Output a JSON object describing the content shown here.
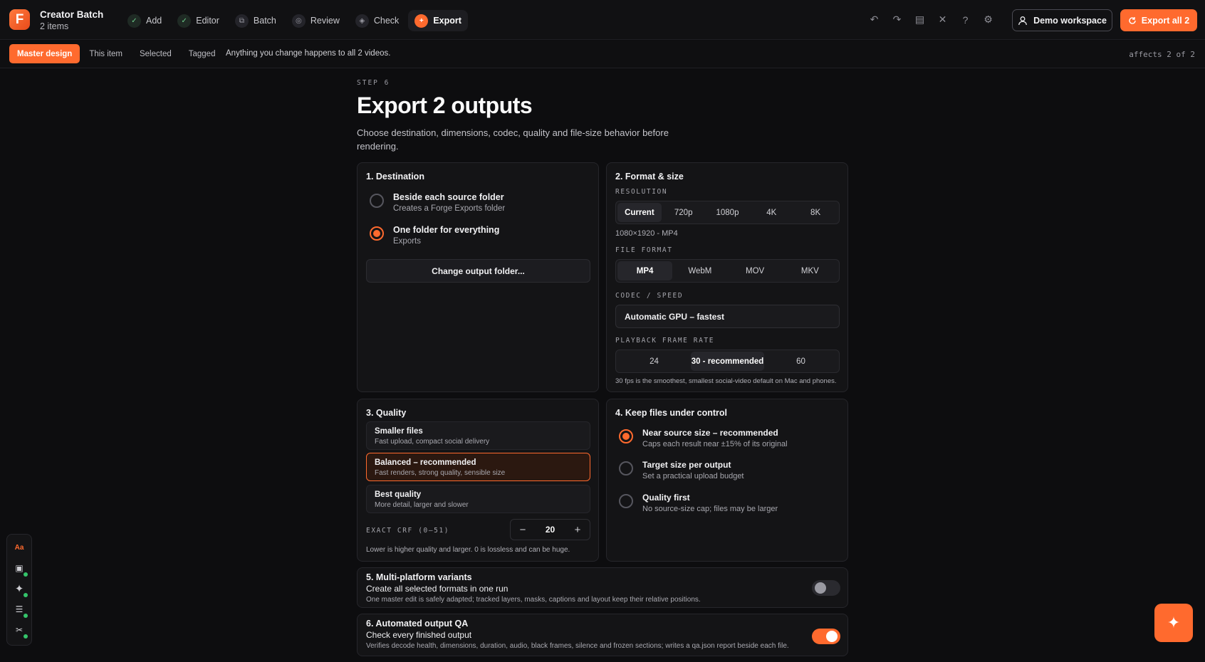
{
  "app": {
    "logo_letter": "F",
    "title": "Creator Batch",
    "subtitle": "2 items"
  },
  "steps": [
    {
      "label": "Add",
      "state": "done"
    },
    {
      "label": "Editor",
      "state": "done"
    },
    {
      "label": "Batch",
      "state": "pending"
    },
    {
      "label": "Review",
      "state": "pending"
    },
    {
      "label": "Check",
      "state": "pending"
    },
    {
      "label": "Export",
      "state": "active"
    }
  ],
  "toolbar": {
    "workspace_label": "Demo workspace",
    "export_label": "Export all 2",
    "icons": [
      "undo-icon",
      "redo-icon",
      "list-icon",
      "close-icon",
      "help-icon",
      "gear-icon"
    ]
  },
  "scope": {
    "tabs": [
      {
        "label": "Master design",
        "active": true
      },
      {
        "label": "This item",
        "active": false
      },
      {
        "label": "Selected",
        "active": false
      },
      {
        "label": "Tagged",
        "active": false
      }
    ],
    "message": "Anything you change happens to all 2 videos.",
    "affects": "affects 2 of 2"
  },
  "page": {
    "step_label": "STEP 6",
    "title": "Export 2 outputs",
    "description": "Choose destination, dimensions, codec, quality and file-size behavior before rendering."
  },
  "destination": {
    "title": "1. Destination",
    "options": [
      {
        "label": "Beside each source folder",
        "sub": "Creates a Forge Exports folder",
        "selected": false
      },
      {
        "label": "One folder for everything",
        "sub": "Exports",
        "selected": true
      }
    ],
    "change_button": "Change output folder..."
  },
  "format": {
    "title": "2. Format & size",
    "resolution_label": "RESOLUTION",
    "resolutions": [
      "Current",
      "720p",
      "1080p",
      "4K",
      "8K"
    ],
    "resolution_selected": "Current",
    "resolution_note": "1080×1920 - MP4",
    "file_format_label": "FILE FORMAT",
    "file_formats": [
      "MP4",
      "WebM",
      "MOV",
      "MKV"
    ],
    "file_format_selected": "MP4",
    "codec_label": "CODEC / SPEED",
    "codec_value": "Automatic GPU – fastest",
    "framerate_label": "PLAYBACK FRAME RATE",
    "framerates": [
      "24",
      "30 - recommended",
      "60"
    ],
    "framerate_selected": "30 - recommended",
    "framerate_note": "30 fps is the smoothest, smallest social-video default on Mac and phones."
  },
  "quality": {
    "title": "3. Quality",
    "options": [
      {
        "label": "Smaller files",
        "sub": "Fast upload, compact social delivery",
        "selected": false
      },
      {
        "label": "Balanced – recommended",
        "sub": "Fast renders, strong quality, sensible size",
        "selected": true
      },
      {
        "label": "Best quality",
        "sub": "More detail, larger and slower",
        "selected": false
      }
    ],
    "crf_label": "EXACT CRF (0–51)",
    "crf_value": "20",
    "crf_note": "Lower is higher quality and larger. 0 is lossless and can be huge."
  },
  "filesize": {
    "title": "4. Keep files under control",
    "options": [
      {
        "label": "Near source size – recommended",
        "sub": "Caps each result near ±15% of its original",
        "selected": true
      },
      {
        "label": "Target size per output",
        "sub": "Set a practical upload budget",
        "selected": false
      },
      {
        "label": "Quality first",
        "sub": "No source-size cap; files may be larger",
        "selected": false
      }
    ]
  },
  "variants": {
    "title": "5. Multi-platform variants",
    "heading": "Create all selected formats in one run",
    "description": "One master edit is safely adapted; tracked layers, masks, captions and layout keep their relative positions.",
    "enabled": false
  },
  "qa": {
    "title": "6. Automated output QA",
    "heading": "Check every finished output",
    "description": "Verifies decode health, dimensions, duration, audio, black frames, silence and frozen sections; writes a qa.json report beside each file.",
    "enabled": true
  },
  "dock": {
    "text_tool": "Aa",
    "icons": [
      "text-style-icon",
      "caption-icon",
      "sparkle-icon",
      "sliders-icon",
      "tools-icon"
    ]
  },
  "colors": {
    "accent": "#ff6a2e",
    "background": "#0d0d0f",
    "card": "#141416",
    "success": "#34c46a"
  }
}
